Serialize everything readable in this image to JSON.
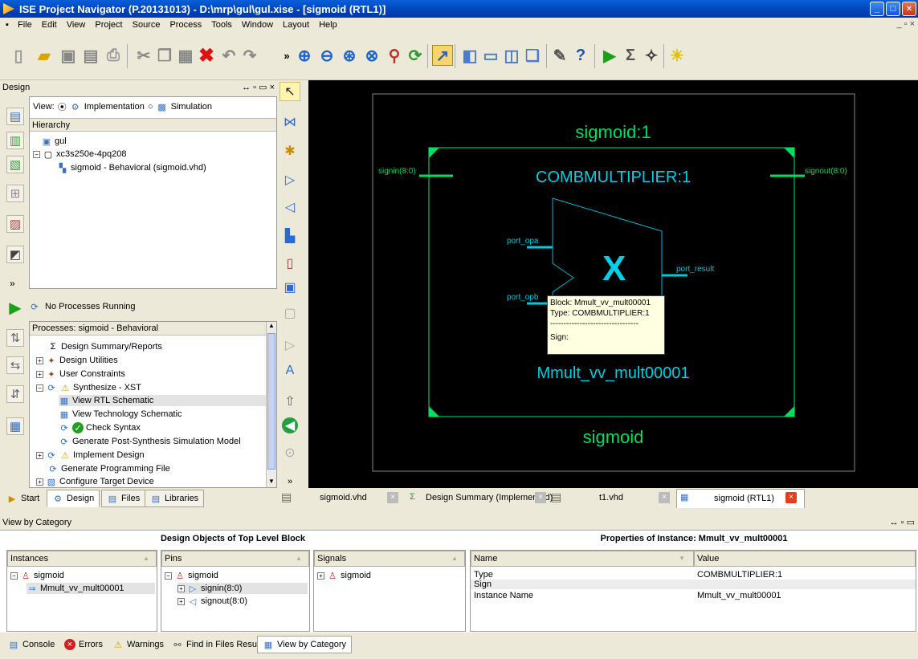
{
  "title": "ISE Project Navigator (P.20131013) - D:\\mrp\\gul\\gul.xise - [sigmoid (RTL1)]",
  "menu": [
    "File",
    "Edit",
    "View",
    "Project",
    "Source",
    "Process",
    "Tools",
    "Window",
    "Layout",
    "Help"
  ],
  "design_panel": {
    "title": "Design",
    "view_label": "View:",
    "impl_label": "Implementation",
    "sim_label": "Simulation",
    "hierarchy_label": "Hierarchy",
    "hierarchy": [
      "gul",
      "xc3s250e-4pq208",
      "sigmoid - Behavioral (sigmoid.vhd)"
    ],
    "no_processes": "No Processes Running",
    "processes_label": "Processes: sigmoid - Behavioral",
    "processes": [
      "Design Summary/Reports",
      "Design Utilities",
      "User Constraints",
      "Synthesize - XST",
      "View RTL Schematic",
      "View Technology Schematic",
      "Check Syntax",
      "Generate Post-Synthesis Simulation Model",
      "Implement Design",
      "Generate Programming File",
      "Configure Target Device"
    ],
    "tabs": [
      "Start",
      "Design",
      "Files",
      "Libraries"
    ]
  },
  "schematic": {
    "outer_label": "sigmoid:1",
    "inner_label": "COMBMULTIPLIER:1",
    "bottom_label": "sigmoid",
    "instance_label": "Mmult_vv_mult00001",
    "pin_in": "signin(8:0)",
    "pin_out": "signout(8:0)",
    "port_a": "port_opa",
    "port_b": "port_opb",
    "port_r": "port_result",
    "symbol": "X",
    "tooltip": [
      "Block: Mmult_vv_mult00001",
      "Type: COMBMULTIPLIER:1",
      "---------------------------------",
      "Sign:"
    ]
  },
  "doc_tabs": [
    "sigmoid.vhd",
    "Design Summary (Implemented)",
    "t1.vhd",
    "sigmoid (RTL1)"
  ],
  "view_by_category": {
    "title": "View by Category",
    "objects_title": "Design Objects of Top Level Block",
    "props_title": "Properties of Instance: Mmult_vv_mult00001",
    "instances_hdr": "Instances",
    "pins_hdr": "Pins",
    "signals_hdr": "Signals",
    "name_hdr": "Name",
    "value_hdr": "Value",
    "instances": [
      "sigmoid",
      "Mmult_vv_mult00001"
    ],
    "pins": [
      "sigmoid",
      "signin(8:0)",
      "signout(8:0)"
    ],
    "signals": [
      "sigmoid"
    ],
    "props": [
      {
        "name": "Type",
        "value": "COMBMULTIPLIER:1"
      },
      {
        "name": "Sign",
        "value": ""
      },
      {
        "name": "Instance Name",
        "value": "Mmult_vv_mult00001"
      }
    ]
  },
  "bottom_tabs": [
    "Console",
    "Errors",
    "Warnings",
    "Find in Files Results",
    "View by Category"
  ],
  "colors": {
    "accent": "#00e060",
    "wire": "#00c8e0",
    "titlebar": "#0a5fd8"
  }
}
